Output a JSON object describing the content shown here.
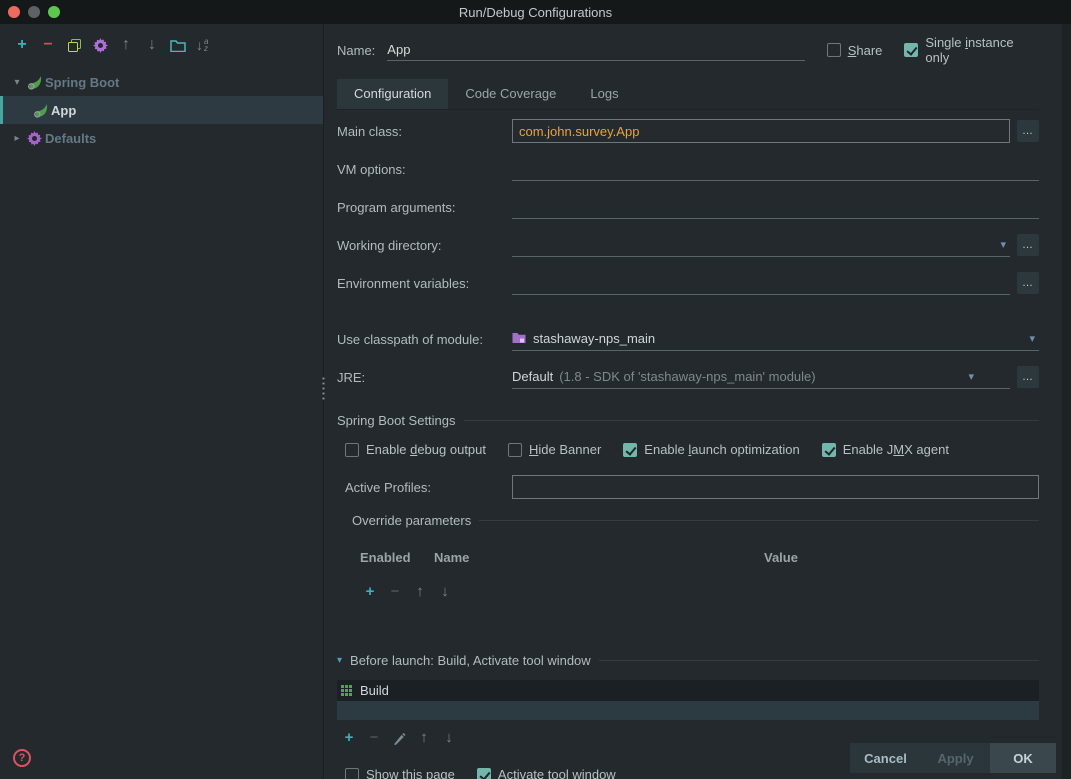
{
  "window": {
    "title": "Run/Debug Configurations"
  },
  "glyphs": {
    "add": "+",
    "remove": "−",
    "move_up": "↑",
    "move_down": "↓",
    "sort_a": "a",
    "sort_z": "z",
    "chevron_down": "▾",
    "chevron_right": "▸",
    "dropdown": "▾",
    "ellipsis": "…",
    "help": "?"
  },
  "colors": {
    "accent_teal": "#73b6ac",
    "selection_bar": "#4aa5a0",
    "selection_bg": "#2d3a42",
    "main_class_value": "#e9a33f",
    "help_icon": "#df5260"
  },
  "sidebar": {
    "tree": [
      {
        "label": "Spring Boot",
        "expanded": true,
        "children": [
          {
            "label": "App",
            "selected": true
          }
        ]
      },
      {
        "label": "Defaults",
        "expanded": false
      }
    ]
  },
  "header": {
    "name_label": "Name:",
    "name_value": "App",
    "share": {
      "pre": "",
      "key": "S",
      "post": "hare",
      "checked": false
    },
    "single_instance": {
      "pre": "Single ",
      "key": "i",
      "post": "nstance only",
      "checked": true
    }
  },
  "tabs": [
    {
      "label": "Configuration",
      "selected": true
    },
    {
      "label": "Code Coverage",
      "selected": false
    },
    {
      "label": "Logs",
      "selected": false
    }
  ],
  "form": {
    "main_class": {
      "label": "Main class:",
      "value": "com.john.survey.App"
    },
    "vm_options": {
      "label": "VM options:",
      "value": ""
    },
    "program_arguments": {
      "label": "Program arguments:",
      "value": ""
    },
    "working_directory": {
      "label": "Working directory:",
      "value": ""
    },
    "environment_variables": {
      "label": "Environment variables:",
      "value": ""
    },
    "module": {
      "label": "Use classpath of module:",
      "value": "stashaway-nps_main"
    },
    "jre": {
      "label": "JRE:",
      "value": "Default",
      "hint": "(1.8 - SDK of 'stashaway-nps_main' module)"
    }
  },
  "spring_boot": {
    "section_title": "Spring Boot Settings",
    "options": [
      {
        "pre": "Enable ",
        "key": "d",
        "post": "ebug output",
        "checked": false
      },
      {
        "pre": "",
        "key": "H",
        "post": "ide Banner",
        "checked": false
      },
      {
        "pre": "Enable ",
        "key": "l",
        "post": "aunch optimization",
        "checked": true
      },
      {
        "pre": "Enable J",
        "key": "M",
        "post": "X agent",
        "checked": true
      }
    ],
    "active_profiles_label": "Active Profiles:",
    "active_profiles_value": "",
    "override": {
      "title": "Override parameters",
      "headers": [
        "Enabled",
        "Name",
        "Value"
      ]
    }
  },
  "before_launch": {
    "title": "Before launch: Build, Activate tool window",
    "items": [
      {
        "label": "Build"
      }
    ],
    "show_this_page": {
      "label": "Show this page",
      "checked": false
    },
    "activate_tool_window": {
      "label": "Activate tool window",
      "checked": true
    }
  },
  "footer": {
    "cancel_label": "Cancel",
    "apply_label": "Apply",
    "ok_label": "OK"
  }
}
